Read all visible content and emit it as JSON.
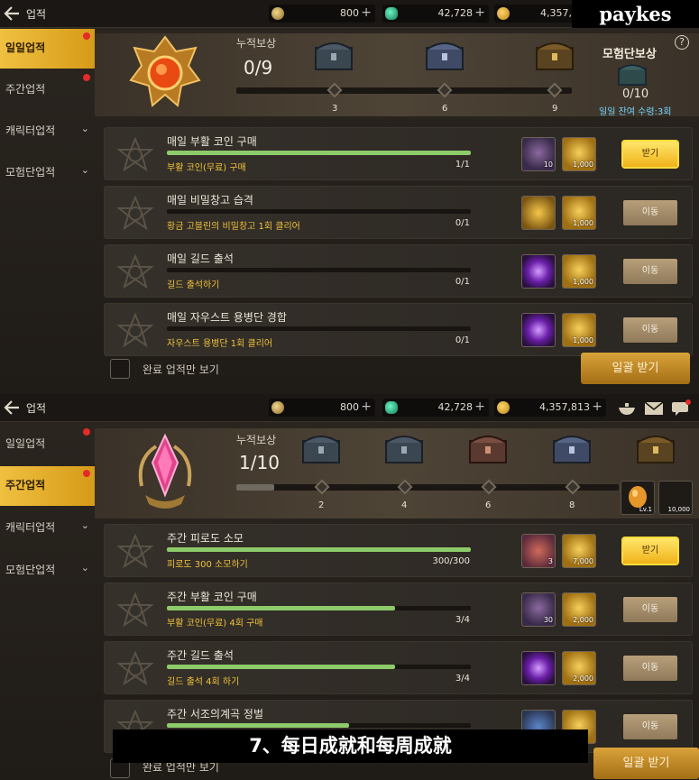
{
  "top_panel": {
    "title": "업적",
    "currency": [
      {
        "name": "coin",
        "value": "800",
        "plus": "+"
      },
      {
        "name": "gem",
        "value": "42,728",
        "plus": "+"
      },
      {
        "name": "gold",
        "value": "4,357,"
      }
    ],
    "sidebar": [
      {
        "label": "일일업적",
        "active": true,
        "dot": true
      },
      {
        "label": "주간업적",
        "dot": true
      },
      {
        "label": "캐릭터업적",
        "chevron": "⌄"
      },
      {
        "label": "모험단업적",
        "chevron": "⌄"
      }
    ],
    "banner": {
      "acc_label": "누적보상",
      "acc_value": "0/9",
      "progress_fraction": 0,
      "milestones": [
        "3",
        "6",
        "9"
      ],
      "group_reward_title": "모험단보상",
      "group_reward_count": "0/10",
      "group_reward_remaining": "일일 잔여 수령:3회",
      "help": "?"
    },
    "tasks": [
      {
        "name": "매일 부활 코인 구매",
        "desc": "부활 코인(무료) 구매",
        "progress": "1/1",
        "fraction": 1.0,
        "rewards": [
          {
            "kind": "item",
            "qty": "10"
          },
          {
            "kind": "coin",
            "qty": "1,000"
          }
        ],
        "action": "받기",
        "claim": true
      },
      {
        "name": "매일 비밀창고 습격",
        "desc": "황금 고블린의 비밀창고 1회 클리어",
        "progress": "0/1",
        "fraction": 0.0,
        "rewards": [
          {
            "kind": "gold",
            "qty": ""
          },
          {
            "kind": "coin",
            "qty": "1,000"
          }
        ],
        "action": "이동",
        "claim": false
      },
      {
        "name": "매일 길드 출석",
        "desc": "길드 출석하기",
        "progress": "0/1",
        "fraction": 0.0,
        "rewards": [
          {
            "kind": "purple",
            "qty": ""
          },
          {
            "kind": "coin",
            "qty": "1,000"
          }
        ],
        "action": "이동",
        "claim": false
      },
      {
        "name": "매일 자우스트 용병단 경합",
        "desc": "자우스트 용병단 1회 클리어",
        "progress": "0/1",
        "fraction": 0.0,
        "rewards": [
          {
            "kind": "purple",
            "qty": ""
          },
          {
            "kind": "coin",
            "qty": "1,000"
          }
        ],
        "action": "이동",
        "claim": false
      }
    ],
    "footer": {
      "checkbox_label": "완료 업적만 보기",
      "claim_all": "일괄 받기"
    }
  },
  "bottom_panel": {
    "title": "업적",
    "currency": [
      {
        "name": "coin",
        "value": "800",
        "plus": "+"
      },
      {
        "name": "gem",
        "value": "42,728",
        "plus": "+"
      },
      {
        "name": "gold",
        "value": "4,357,813",
        "plus": "+"
      }
    ],
    "sidebar": [
      {
        "label": "일일업적",
        "dot": true
      },
      {
        "label": "주간업적",
        "active": true,
        "dot": true
      },
      {
        "label": "캐릭터업적",
        "chevron": "⌄"
      },
      {
        "label": "모험단업적",
        "chevron": "⌄"
      }
    ],
    "banner": {
      "acc_label": "누적보상",
      "acc_value": "1/10",
      "progress_fraction": 0.1,
      "milestones": [
        "2",
        "4",
        "6",
        "8"
      ],
      "tooltip_rewards": [
        {
          "kind": "egg",
          "qty": "Lv.1"
        },
        {
          "kind": "coin",
          "qty": "10,000"
        }
      ]
    },
    "tasks": [
      {
        "name": "주간 피로도 소모",
        "desc": "피로도 300 소모하기",
        "progress": "300/300",
        "fraction": 1.0,
        "rewards": [
          {
            "kind": "red",
            "qty": "3"
          },
          {
            "kind": "coin",
            "qty": "7,000"
          }
        ],
        "action": "받기",
        "claim": true
      },
      {
        "name": "주간 부활 코인 구매",
        "desc": "부활 코인(무료) 4회 구매",
        "progress": "3/4",
        "fraction": 0.75,
        "rewards": [
          {
            "kind": "item",
            "qty": "30"
          },
          {
            "kind": "coin",
            "qty": "2,000"
          }
        ],
        "action": "이동",
        "claim": false
      },
      {
        "name": "주간 길드 출석",
        "desc": "길드 출석 4회 하기",
        "progress": "3/4",
        "fraction": 0.75,
        "rewards": [
          {
            "kind": "purple",
            "qty": ""
          },
          {
            "kind": "coin",
            "qty": "2,000"
          }
        ],
        "action": "이동",
        "claim": false
      },
      {
        "name": "주간 서조의계곡 정벌",
        "desc": "",
        "progress": "",
        "fraction": 0.6,
        "rewards": [
          {
            "kind": "blue",
            "qty": ""
          },
          {
            "kind": "coin",
            "qty": ""
          }
        ],
        "action": "이동",
        "claim": false
      }
    ],
    "footer": {
      "checkbox_label": "완료 업적만 보기",
      "claim_all": "일괄 받기"
    }
  },
  "overlays": {
    "watermark": "paykes",
    "caption": "7、每日成就和每周成就"
  }
}
